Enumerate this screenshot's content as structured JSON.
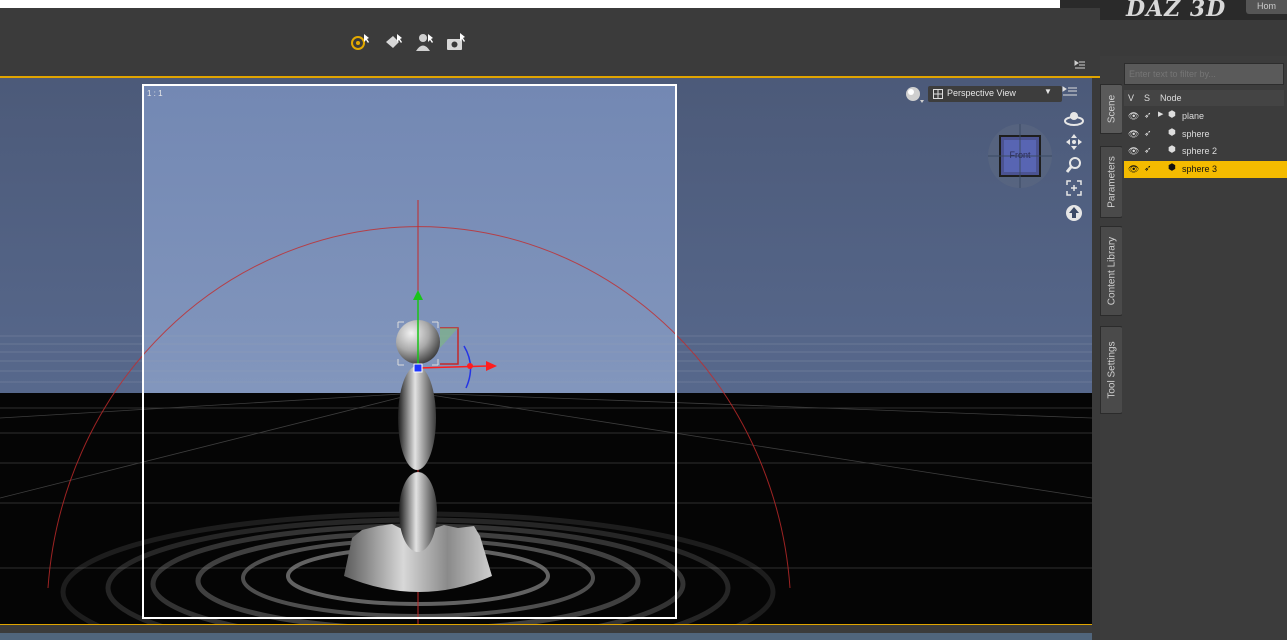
{
  "brand": {
    "logo_text": "DAZ 3D",
    "home_label": "Hom"
  },
  "toolbar": {
    "icons": [
      "universal-tool-icon",
      "node-weight-brush-icon",
      "figure-tool-icon",
      "camera-tool-icon"
    ]
  },
  "viewport": {
    "aspect_label": "1 : 1",
    "view_selector": "Perspective View",
    "cube_face_label": "Front",
    "colors": {
      "sky": "#7a90b8",
      "floor": "#050505",
      "frame": "#ffffff",
      "guide": "#cc2b2b"
    }
  },
  "side_tabs": [
    "Scene",
    "Parameters",
    "Content Library",
    "Tool Settings"
  ],
  "scene": {
    "filter_placeholder": "Enter text to filter by...",
    "columns": {
      "v": "V",
      "s": "S",
      "node": "Node"
    },
    "nodes": [
      {
        "name": "plane",
        "selected": false
      },
      {
        "name": "sphere",
        "selected": false
      },
      {
        "name": "sphere 2",
        "selected": false
      },
      {
        "name": "sphere 3",
        "selected": true
      }
    ],
    "highlight_color": "#f4bb00"
  }
}
